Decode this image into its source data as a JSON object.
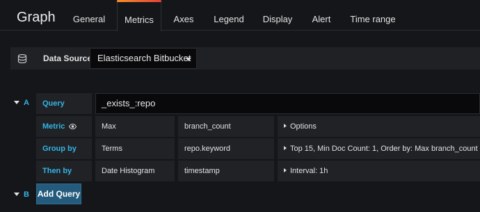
{
  "header": {
    "title": "Graph",
    "tabs": [
      "General",
      "Metrics",
      "Axes",
      "Legend",
      "Display",
      "Alert",
      "Time range"
    ],
    "active_tab": "Metrics"
  },
  "datasource": {
    "label": "Data Source",
    "value": "Elasticsearch Bitbucket",
    "icon": "database-icon"
  },
  "queries": [
    {
      "ref_id": "A",
      "query_label": "Query",
      "query_value": "_exists_:repo",
      "metric": {
        "label": "Metric",
        "agg": "Max",
        "field": "branch_count",
        "options": "Options"
      },
      "group_by": {
        "label": "Group by",
        "type": "Terms",
        "field": "repo.keyword",
        "options": "Top 15, Min Doc Count: 1, Order by: Max branch_count"
      },
      "then_by": {
        "label": "Then by",
        "type": "Date Histogram",
        "field": "timestamp",
        "options": "Interval: 1h"
      }
    },
    {
      "ref_id": "B",
      "add_label": "Add Query"
    }
  ]
}
